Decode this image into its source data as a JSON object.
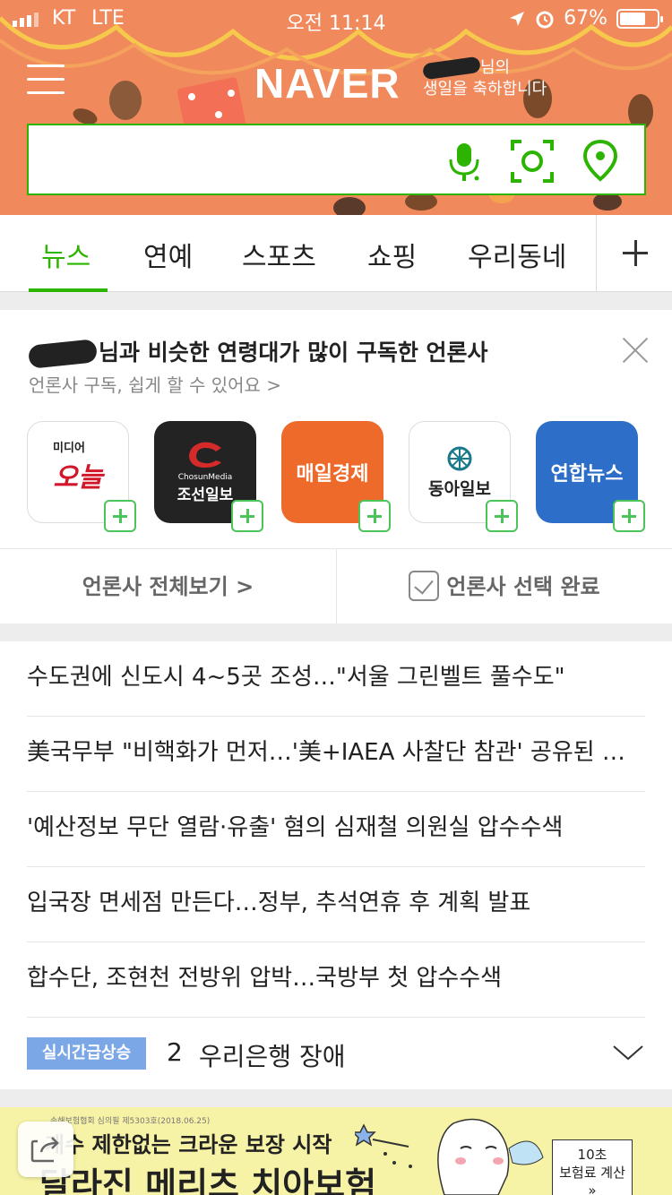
{
  "status_bar": {
    "carrier": "KT",
    "network": "LTE",
    "time": "오전 11:14",
    "battery": "67%"
  },
  "header": {
    "logo": "NAVER",
    "birthday_line1_suffix": "님의",
    "birthday_line2": "생일을 축하합니다",
    "brand_color": "#2db400",
    "background_color": "#f08a5d"
  },
  "search": {
    "value": "",
    "icons": [
      "microphone-icon",
      "camera-lens-icon",
      "location-pin-icon"
    ]
  },
  "tabs": [
    {
      "label": "뉴스",
      "active": true
    },
    {
      "label": "연예",
      "active": false
    },
    {
      "label": "스포츠",
      "active": false
    },
    {
      "label": "쇼핑",
      "active": false
    },
    {
      "label": "우리동네",
      "active": false
    }
  ],
  "subscribe_card": {
    "title_suffix": "님과 비슷한 연령대가 많이 구독한 언론사",
    "subtitle": "언론사 구독, 쉽게 할 수 있어요 >",
    "presses": [
      {
        "name": "미디어 오늘",
        "line1": "미디어",
        "line2": "오늘"
      },
      {
        "name": "조선일보",
        "line1": "ChosunMedia",
        "line2": "조선일보"
      },
      {
        "name": "매일경제",
        "line1": "매일경제"
      },
      {
        "name": "동아일보",
        "line1": "동아일보"
      },
      {
        "name": "연합뉴스",
        "line1": "연합뉴스"
      }
    ],
    "view_all": "언론사 전체보기 >",
    "select_done": "언론사 선택 완료"
  },
  "headlines": [
    "수도권에 신도시 4~5곳 조성…\"서울 그린벨트 풀수도\"",
    "美국무부 \"비핵화가 먼저…'美+IAEA 사찰단 참관' 공유된 …",
    "'예산정보 무단 열람·유출' 혐의 심재철 의원실 압수수색",
    "입국장 면세점 만든다…정부, 추석연휴 후 계획 발표",
    "합수단, 조현천 전방위 압박…국방부 첫 압수수색"
  ],
  "realtime": {
    "badge": "실시간급상승",
    "rank": "2",
    "keyword": "우리은행 장애"
  },
  "ad": {
    "fine_print": "손해보험협회 심의필 제5303호(2018.06.25)",
    "line1": "개수 제한없는 크라운 보장 시작",
    "line2": "달라진 메리츠 치아보험",
    "cta_line1": "10초",
    "cta_line2": "보험료 계산",
    "cta_line3": "»"
  }
}
